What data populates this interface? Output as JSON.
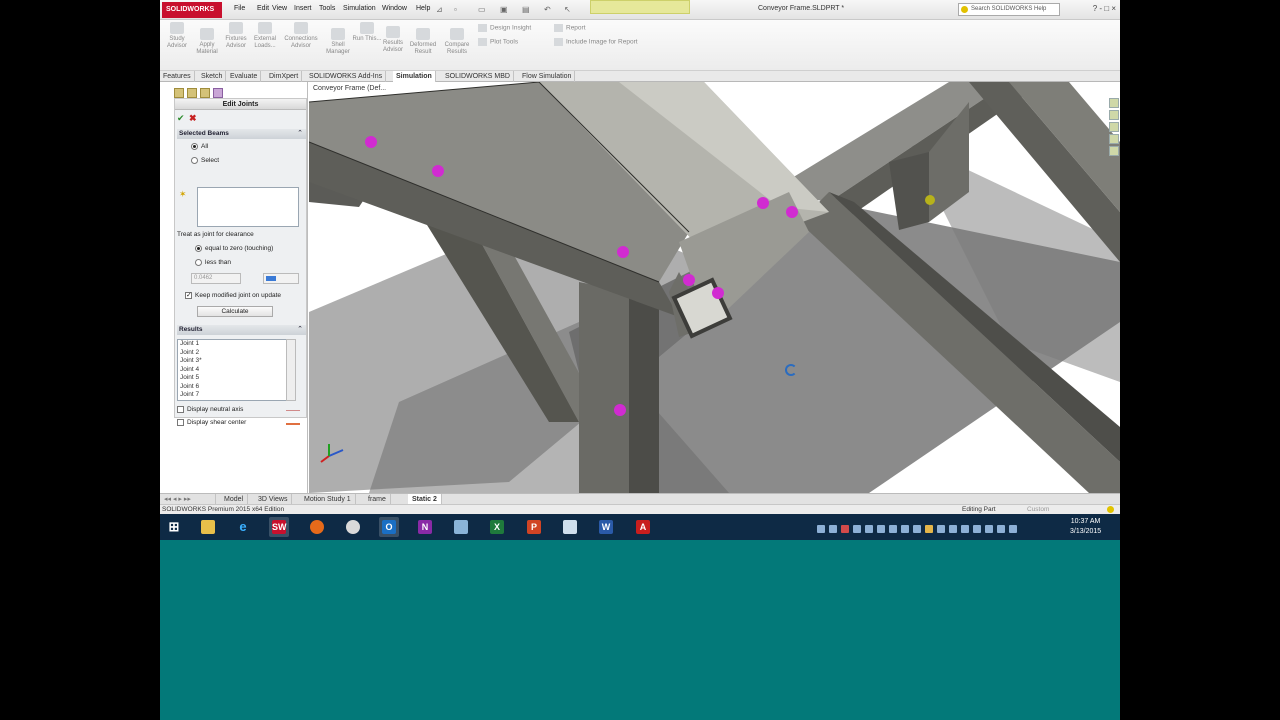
{
  "app": {
    "logo": "SOLIDWORKS",
    "menu": [
      "File",
      "Edit",
      "View",
      "Insert",
      "Tools",
      "Simulation",
      "Window",
      "Help"
    ],
    "document_title": "Conveyor Frame.SLDPRT *",
    "search_placeholder": "Search SOLIDWORKS Help",
    "window_controls": "? - □ ×"
  },
  "command_manager": {
    "buttons": [
      {
        "label": "Study Advisor",
        "icon": "study-advisor-icon"
      },
      {
        "label": "Apply Material",
        "icon": "apply-material-icon"
      },
      {
        "label": "Fixtures Advisor",
        "icon": "fixtures-icon"
      },
      {
        "label": "External Loads...",
        "icon": "external-loads-icon"
      },
      {
        "label": "Connections Advisor",
        "icon": "connections-icon"
      },
      {
        "label": "Shell Manager",
        "icon": "shell-manager-icon"
      },
      {
        "label": "Run This...",
        "icon": "run-icon"
      },
      {
        "label": "Results Advisor",
        "icon": "results-advisor-icon"
      },
      {
        "label": "Deformed Result",
        "icon": "deformed-result-icon"
      },
      {
        "label": "Compare Results",
        "icon": "compare-results-icon"
      }
    ],
    "small_buttons": [
      "Design Insight",
      "Plot Tools",
      "Report",
      "Include Image for Report"
    ]
  },
  "tabs": [
    "Features",
    "Sketch",
    "Evaluate",
    "DimXpert",
    "SOLIDWORKS Add-Ins",
    "Simulation",
    "SOLIDWORKS MBD",
    "Flow Simulation"
  ],
  "active_tab": "Simulation",
  "property_manager": {
    "title": "Edit Joints",
    "ok": "✔",
    "cancel": "✖",
    "selected_beams": {
      "header": "Selected Beams",
      "option_all": "All",
      "option_select": "Select"
    },
    "treat_label": "Treat as joint for clearance",
    "option_equal": "equal to zero (touching)",
    "option_less": "less than",
    "clearance_value": "0.0462",
    "keep_modified": "Keep modified joint on update",
    "calculate": "Calculate",
    "results": {
      "header": "Results",
      "items": [
        "Joint 1",
        "Joint 2",
        "Joint 3*",
        "Joint 4",
        "Joint 5",
        "Joint 6",
        "Joint 7"
      ]
    },
    "display_neutral_axis": "Display neutral axis",
    "display_shear_center": "Display shear center"
  },
  "viewport": {
    "tree_label": "Conveyor Frame (Def..."
  },
  "bottom_tabs": [
    "Model",
    "3D Views",
    "Motion Study 1",
    "frame",
    "Static 2"
  ],
  "active_bottom_tab": "Static 2",
  "status": {
    "left": "SOLIDWORKS Premium 2015 x64 Edition",
    "mode": "Editing Part",
    "units": "Custom"
  },
  "taskbar": {
    "apps": [
      "windows-start",
      "file-explorer",
      "internet-explorer",
      "solidworks",
      "firefox",
      "paint",
      "outlook",
      "onenote",
      "network",
      "excel",
      "powerpoint",
      "notepad",
      "word",
      "acrobat"
    ],
    "time": "10:37 AM",
    "date": "3/13/2015"
  },
  "colors": {
    "joint_marker": "#d12bd1",
    "joint_marker_yellow": "#b7b21b",
    "desktop": "#037979",
    "taskbar": "#0e2a45",
    "logo": "#c8102e"
  }
}
